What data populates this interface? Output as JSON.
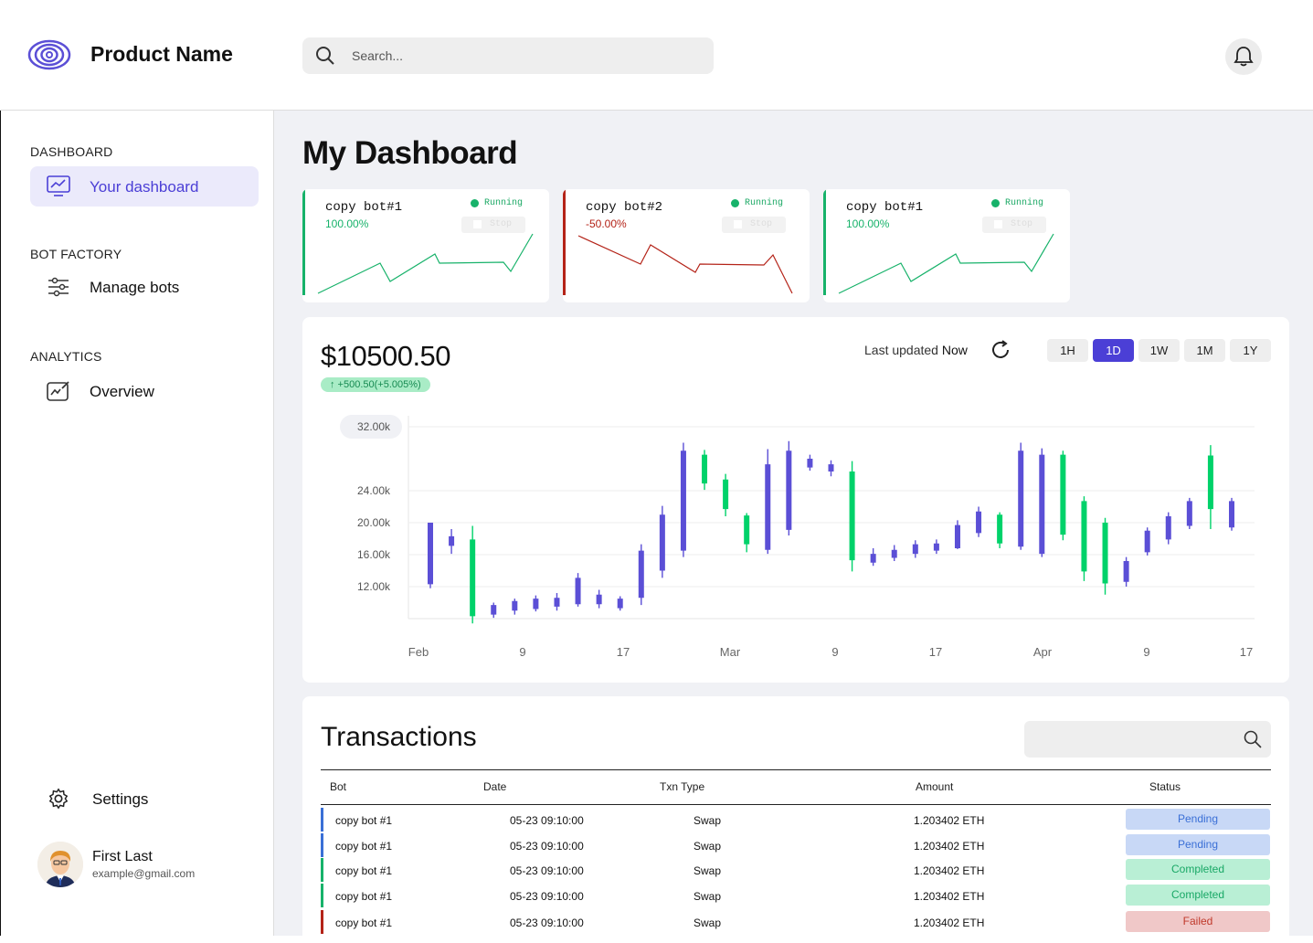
{
  "header": {
    "product_name": "Product Name",
    "search_placeholder": "Search...",
    "logo_icon": "spiral-logo-icon",
    "notification_icon": "bell-icon"
  },
  "sidebar": {
    "sections": [
      {
        "title": "DASHBOARD",
        "items": [
          {
            "label": "Your dashboard",
            "icon": "monitor-chart-icon",
            "active": true
          }
        ]
      },
      {
        "title": "BOT FACTORY",
        "items": [
          {
            "label": "Manage bots",
            "icon": "sliders-icon",
            "active": false
          }
        ]
      },
      {
        "title": "ANALYTICS",
        "items": [
          {
            "label": "Overview",
            "icon": "chart-edit-icon",
            "active": false
          }
        ]
      }
    ],
    "settings_label": "Settings",
    "user": {
      "name": "First Last",
      "email": "example@gmail.com"
    }
  },
  "main": {
    "title": "My Dashboard",
    "bots": [
      {
        "name": "copy bot#1",
        "pct": "100.00%",
        "status": "Running",
        "stop_label": "Stop",
        "trend": "up",
        "color": "#17b26a"
      },
      {
        "name": "copy bot#2",
        "pct": "-50.00%",
        "status": "Running",
        "stop_label": "Stop",
        "trend": "down",
        "color": "#b42318"
      },
      {
        "name": "copy bot#1",
        "pct": "100.00%",
        "status": "Running",
        "stop_label": "Stop",
        "trend": "up",
        "color": "#17b26a"
      }
    ],
    "price_panel": {
      "price": "$10500.50",
      "change": "↑ +500.50(+5.005%)",
      "last_updated_label": "Last updated",
      "last_updated_value": "Now",
      "ranges": [
        "1H",
        "1D",
        "1W",
        "1M",
        "1Y"
      ],
      "active_range": "1D"
    },
    "transactions": {
      "title": "Transactions",
      "columns": [
        "Bot",
        "Date",
        "Txn Type",
        "Amount",
        "Status"
      ],
      "rows": [
        {
          "bot": "copy bot #1",
          "date": "05-23 09:10:00",
          "type": "Swap",
          "amount": "1.203402 ETH",
          "status": "Pending"
        },
        {
          "bot": "copy bot #1",
          "date": "05-23 09:10:00",
          "type": "Swap",
          "amount": "1.203402 ETH",
          "status": "Pending"
        },
        {
          "bot": "copy bot #1",
          "date": "05-23 09:10:00",
          "type": "Swap",
          "amount": "1.203402 ETH",
          "status": "Completed"
        },
        {
          "bot": "copy bot #1",
          "date": "05-23 09:10:00",
          "type": "Swap",
          "amount": "1.203402 ETH",
          "status": "Completed"
        },
        {
          "bot": "copy bot #1",
          "date": "05-23 09:10:00",
          "type": "Swap",
          "amount": "1.203402 ETH",
          "status": "Failed"
        }
      ]
    }
  },
  "colors": {
    "accent": "#4b3fd6",
    "up": "#00d26a",
    "down": "#5b4fd6",
    "pending": "#c8d8f6",
    "completed": "#b9efd5",
    "failed": "#f0c8c8"
  },
  "chart_data": {
    "type": "candlestick",
    "x_ticks": [
      "Feb",
      "9",
      "17",
      "Mar",
      "9",
      "17",
      "Apr",
      "9",
      "17"
    ],
    "y_ticks": [
      "12.00k",
      "16.00k",
      "20.00k",
      "24.00k",
      "32.00k"
    ],
    "ylim": [
      8000,
      32000
    ],
    "candles": [
      [
        20000,
        12300,
        20000,
        11800,
        "down"
      ],
      [
        18300,
        17100,
        19200,
        16100,
        "down"
      ],
      [
        17900,
        8300,
        19600,
        7400,
        "up"
      ],
      [
        8500,
        9700,
        10000,
        8100,
        "down"
      ],
      [
        9000,
        10200,
        10500,
        8500,
        "down"
      ],
      [
        9200,
        10500,
        10900,
        8900,
        "down"
      ],
      [
        9500,
        10600,
        11200,
        9000,
        "down"
      ],
      [
        9800,
        13100,
        13700,
        9500,
        "down"
      ],
      [
        9800,
        11000,
        11600,
        9300,
        "down"
      ],
      [
        9300,
        10500,
        10800,
        9000,
        "down"
      ],
      [
        10600,
        16500,
        17300,
        9700,
        "down"
      ],
      [
        14000,
        21000,
        22100,
        13100,
        "down"
      ],
      [
        16500,
        29000,
        30000,
        15700,
        "down"
      ],
      [
        28500,
        24900,
        29100,
        24100,
        "up"
      ],
      [
        25400,
        21700,
        26100,
        20800,
        "up"
      ],
      [
        20900,
        17300,
        21200,
        16300,
        "up"
      ],
      [
        16600,
        27300,
        29200,
        16100,
        "down"
      ],
      [
        19100,
        29000,
        30200,
        18400,
        "down"
      ],
      [
        26900,
        28000,
        28500,
        26500,
        "down"
      ],
      [
        26400,
        27300,
        27800,
        25800,
        "down"
      ],
      [
        26400,
        15300,
        27700,
        13900,
        "up"
      ],
      [
        15000,
        16100,
        16800,
        14600,
        "down"
      ],
      [
        15600,
        16600,
        17200,
        15200,
        "down"
      ],
      [
        16100,
        17300,
        17800,
        15600,
        "down"
      ],
      [
        16500,
        17400,
        17900,
        16100,
        "down"
      ],
      [
        16800,
        19700,
        20300,
        16700,
        "down"
      ],
      [
        18700,
        21400,
        22000,
        18200,
        "down"
      ],
      [
        21000,
        17400,
        21300,
        16800,
        "up"
      ],
      [
        17000,
        29000,
        30000,
        16600,
        "down"
      ],
      [
        16100,
        28500,
        29300,
        15700,
        "down"
      ],
      [
        28500,
        18500,
        29000,
        17800,
        "up"
      ],
      [
        22700,
        13900,
        23300,
        12700,
        "up"
      ],
      [
        20000,
        12400,
        20600,
        11000,
        "up"
      ],
      [
        12600,
        15200,
        15700,
        12000,
        "down"
      ],
      [
        16300,
        19000,
        19400,
        15900,
        "down"
      ],
      [
        17900,
        20800,
        21300,
        17300,
        "down"
      ],
      [
        19600,
        22700,
        23100,
        19200,
        "down"
      ],
      [
        28400,
        21700,
        29700,
        19200,
        "up"
      ],
      [
        19400,
        22700,
        23100,
        19000,
        "down"
      ]
    ]
  }
}
